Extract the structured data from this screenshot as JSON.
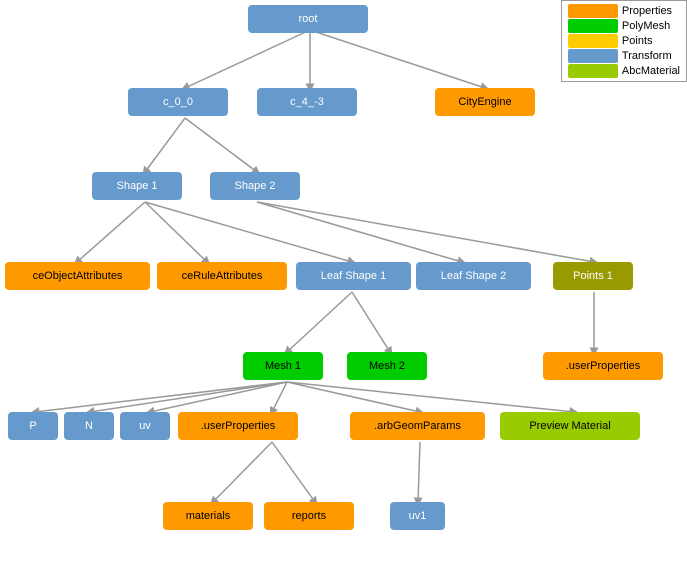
{
  "legend": {
    "items": [
      {
        "label": "Properties",
        "color": "#ff9900"
      },
      {
        "label": "PolyMesh",
        "color": "#00cc00"
      },
      {
        "label": "Points",
        "color": "#ffcc00"
      },
      {
        "label": "Transform",
        "color": "#6699cc"
      },
      {
        "label": "AbcMaterial",
        "color": "#99cc00"
      }
    ]
  },
  "nodes": {
    "root": {
      "label": "root"
    },
    "c_0_0": {
      "label": "c_0_0"
    },
    "c_4_-3": {
      "label": "c_4_-3"
    },
    "city_engine": {
      "label": "CityEngine"
    },
    "shape1": {
      "label": "Shape 1"
    },
    "shape2": {
      "label": "Shape 2"
    },
    "ce_object": {
      "label": "ceObjectAttributes"
    },
    "ce_rule": {
      "label": "ceRuleAttributes"
    },
    "leaf_shape1": {
      "label": "Leaf Shape 1"
    },
    "leaf_shape2": {
      "label": "Leaf Shape 2"
    },
    "points1": {
      "label": "Points 1"
    },
    "mesh1": {
      "label": "Mesh 1"
    },
    "mesh2": {
      "label": "Mesh 2"
    },
    "user_props_right": {
      "label": ".userProperties"
    },
    "p": {
      "label": "P"
    },
    "n": {
      "label": "N"
    },
    "uv": {
      "label": "uv"
    },
    "user_props": {
      "label": ".userProperties"
    },
    "arb_geom": {
      "label": ".arbGeomParams"
    },
    "preview_material": {
      "label": "Preview Material"
    },
    "materials": {
      "label": "materials"
    },
    "reports": {
      "label": "reports"
    },
    "uv1": {
      "label": "uv1"
    }
  }
}
